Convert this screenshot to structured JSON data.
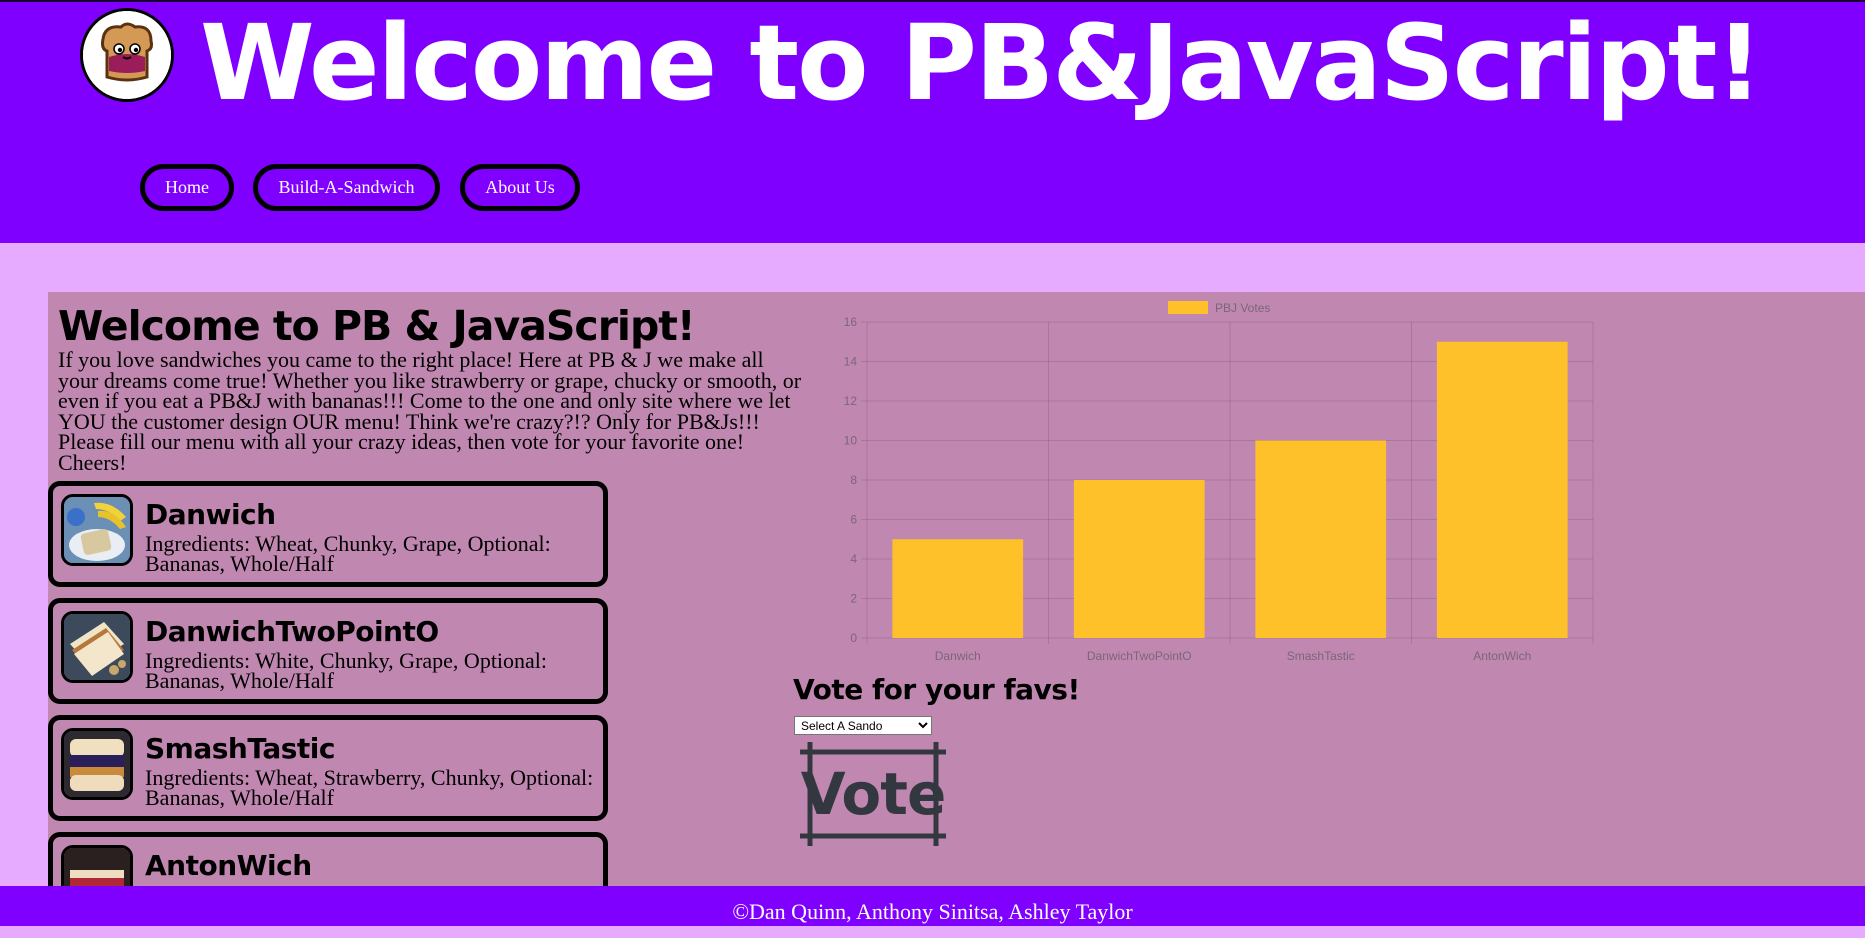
{
  "header": {
    "title": "Welcome to PB&JavaScript!",
    "nav": [
      {
        "label": "Home"
      },
      {
        "label": "Build-A-Sandwich"
      },
      {
        "label": "About Us"
      }
    ]
  },
  "intro": {
    "title": "Welcome to PB & JavaScript!",
    "text": "If you love sandwiches you came to the right place! Here at PB & J we make all your dreams come true! Whether you like strawberry or grape, chucky or smooth, or even if you eat a PB&J with bananas!!! Come to the one and only site where we let YOU the customer design OUR menu! Think we're crazy?!? Only for PB&Js!!! Please fill our menu with all your crazy ideas, then vote for your favorite one! Cheers!"
  },
  "sandwiches": [
    {
      "name": "Danwich",
      "ingredients": "Ingredients: Wheat, Chunky, Grape, Optional: Bananas, Whole/Half"
    },
    {
      "name": "DanwichTwoPointO",
      "ingredients": "Ingredients: White, Chunky, Grape, Optional: Bananas, Whole/Half"
    },
    {
      "name": "SmashTastic",
      "ingredients": "Ingredients: Wheat, Strawberry, Chunky, Optional: Bananas, Whole/Half"
    },
    {
      "name": "AntonWich",
      "ingredients": ""
    }
  ],
  "vote": {
    "title": "Vote for your favs!",
    "select_value": "Select A Sando",
    "button_label": "Vote"
  },
  "footer": {
    "text": "©Dan Quinn, Anthony Sinitsa, Ashley Taylor"
  },
  "colors": {
    "header_bg": "#8000ff",
    "page_bg": "#e6aaff",
    "main_bg": "#c088b0",
    "bar": "#ffc12a"
  },
  "chart_data": {
    "type": "bar",
    "categories": [
      "Danwich",
      "DanwichTwoPointO",
      "SmashTastic",
      "AntonWich"
    ],
    "series": [
      {
        "name": "PBJ Votes",
        "values": [
          5,
          8,
          10,
          15
        ]
      }
    ],
    "ylim": [
      0,
      16
    ],
    "yticks": [
      0,
      2,
      4,
      6,
      8,
      10,
      12,
      14,
      16
    ],
    "legend": "top-center",
    "grid": true
  }
}
